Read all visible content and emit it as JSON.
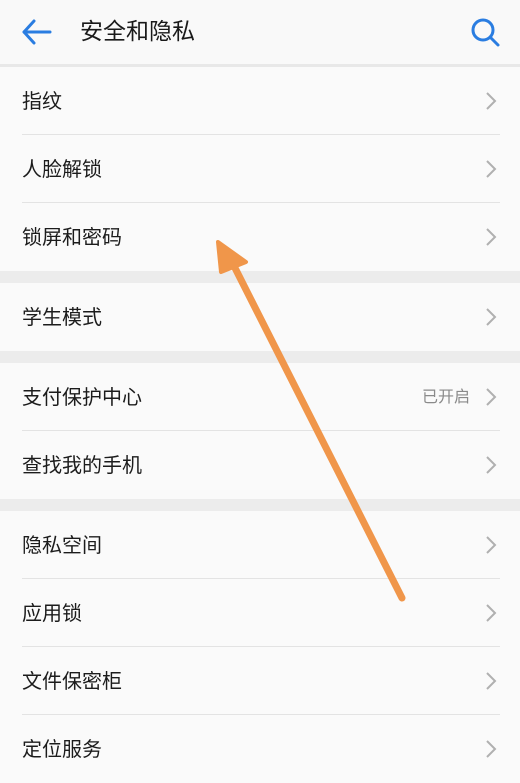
{
  "header": {
    "title": "安全和隐私",
    "back_icon": "arrow-left-icon",
    "search_icon": "search-icon",
    "accent_color": "#2a7de1"
  },
  "groups": [
    {
      "items": [
        {
          "label": "指纹",
          "value": ""
        },
        {
          "label": "人脸解锁",
          "value": ""
        },
        {
          "label": "锁屏和密码",
          "value": ""
        }
      ]
    },
    {
      "items": [
        {
          "label": "学生模式",
          "value": ""
        }
      ]
    },
    {
      "items": [
        {
          "label": "支付保护中心",
          "value": "已开启"
        },
        {
          "label": "查找我的手机",
          "value": ""
        }
      ]
    },
    {
      "items": [
        {
          "label": "隐私空间",
          "value": ""
        },
        {
          "label": "应用锁",
          "value": ""
        },
        {
          "label": "文件保密柜",
          "value": ""
        },
        {
          "label": "定位服务",
          "value": ""
        }
      ]
    }
  ],
  "annotation": {
    "arrow_color": "#f0964a"
  },
  "colors": {
    "background": "#f9f9f9",
    "group_gap": "#ececec",
    "chevron": "#b0b0b0"
  }
}
